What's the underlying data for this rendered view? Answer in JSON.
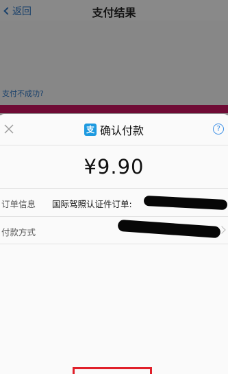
{
  "background": {
    "back_label": "返回",
    "title": "支付结果",
    "fail_link": "支付不成功?",
    "accent_color": "#c0145c"
  },
  "sheet": {
    "logo_char": "支",
    "title": "确认付款",
    "help_char": "?",
    "amount": "¥9.90",
    "order": {
      "label": "订单信息",
      "value": "国际驾照认证件订单:"
    },
    "method": {
      "label": "付款方式"
    },
    "link_color": "#3a8ee6",
    "highlight_color": "#e0202a"
  }
}
